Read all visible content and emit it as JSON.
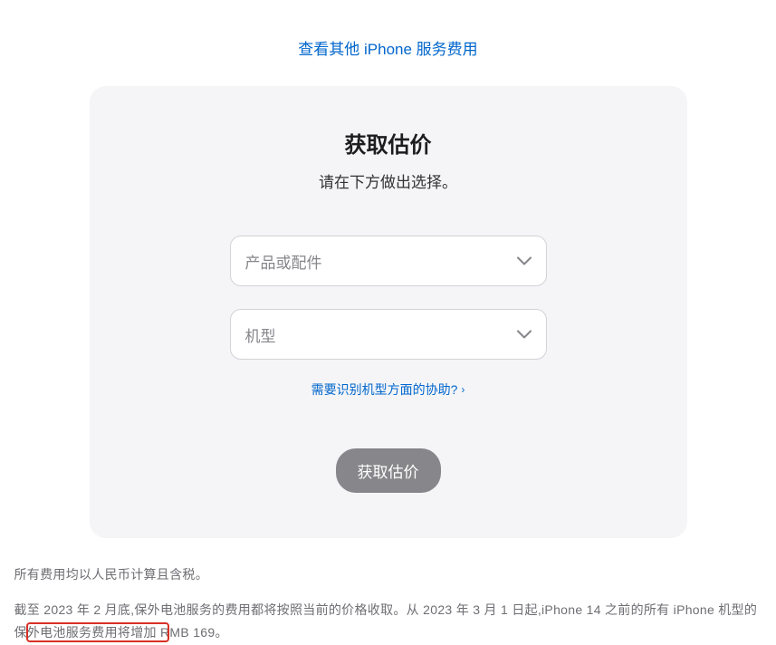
{
  "top_link": "查看其他 iPhone 服务费用",
  "card": {
    "title": "获取估价",
    "subtitle": "请在下方做出选择。",
    "select1": "产品或配件",
    "select2": "机型",
    "help_link": "需要识别机型方面的协助?",
    "button": "获取估价"
  },
  "footer": {
    "line1": "所有费用均以人民币计算且含税。",
    "line2": "截至 2023 年 2 月底,保外电池服务的费用都将按照当前的价格收取。从 2023 年 3 月 1 日起,iPhone 14 之前的所有 iPhone 机型的保外电池服务费用将增加 RMB 169。"
  }
}
